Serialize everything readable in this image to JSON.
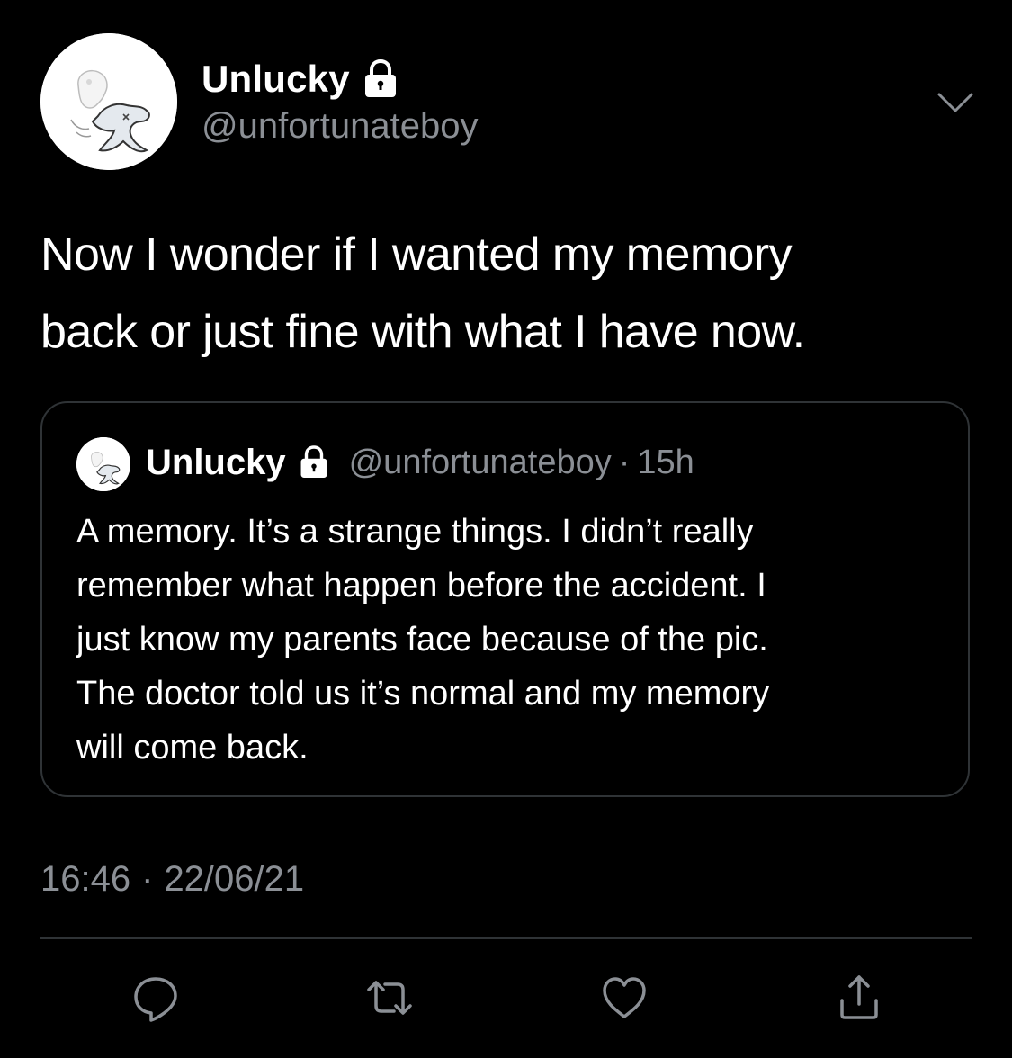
{
  "tweet": {
    "author": {
      "display_name": "Unlucky",
      "handle": "@unfortunateboy",
      "avatar_icon": "ghost-doll-drawing-avatar",
      "protected_icon": "lock-icon"
    },
    "text": "Now I wonder if I wanted  my memory\nback or just fine with what I have now.",
    "time": "16:46",
    "date": "22/06/21",
    "separator": "·",
    "menu_icon": "chevron-down-icon"
  },
  "quoted_tweet": {
    "display_name": "Unlucky",
    "handle": "@unfortunateboy",
    "separator": "·",
    "age": "15h",
    "text": "A memory. It’s a strange things. I didn’t really\nremember what happen before the accident. I\njust know my parents face because of the pic.\nThe doctor told us it’s normal and my memory\nwill come back."
  },
  "actions": {
    "reply_icon": "reply-icon",
    "retweet_icon": "retweet-icon",
    "like_icon": "heart-icon",
    "share_icon": "share-icon"
  },
  "colors": {
    "background": "#000000",
    "text_primary": "#ffffff",
    "text_secondary": "#8b8f95",
    "border": "#2f3336"
  }
}
